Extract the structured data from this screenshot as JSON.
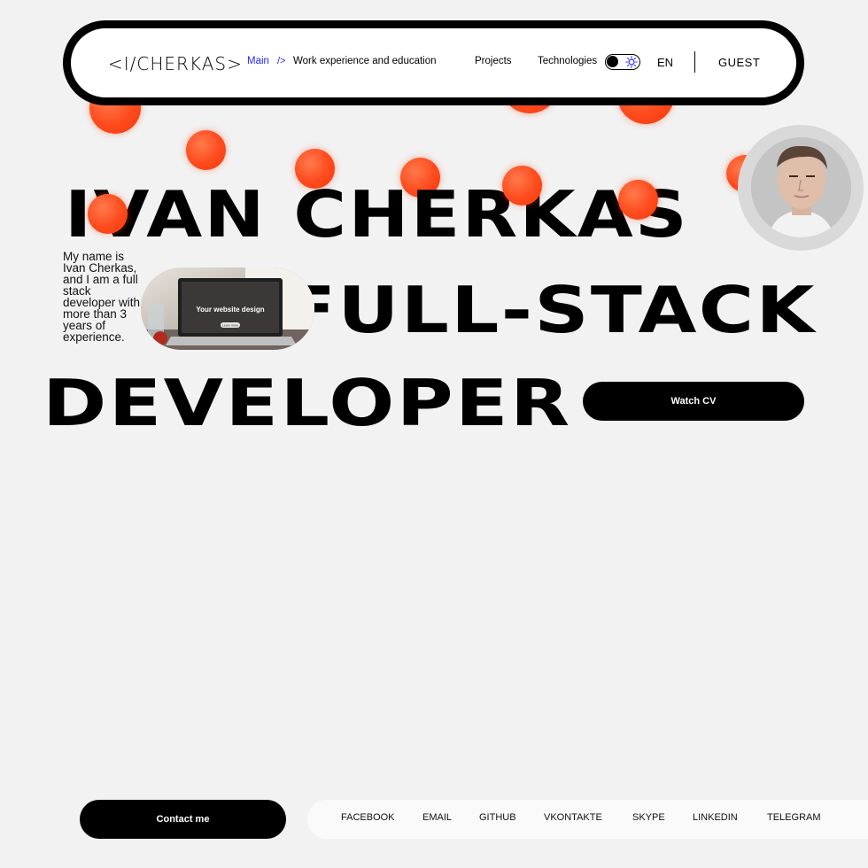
{
  "header": {
    "logo": "<I/CHERKAS>",
    "nav": {
      "main": "Main",
      "main_suffix": "/>",
      "work": "Work experience and education",
      "projects": "Projects",
      "technologies": "Technologies"
    },
    "theme_toggle": {
      "state": "dark",
      "icon": "sun-icon"
    },
    "language": "EN",
    "user": "GUEST"
  },
  "hero": {
    "line1": "IVAN CHERKAS",
    "line2": "FULL-STACK",
    "line3": "DEVELOPER",
    "bio": "My name is Ivan Cherkas, and I am a full stack developer with more than 3 years of experience.",
    "image_caption": "Your website design",
    "image_button": "Learn more",
    "cv_button": "Watch CV"
  },
  "footer": {
    "contact_button": "Contact me",
    "socials": [
      "FACEBOOK",
      "EMAIL",
      "GITHUB",
      "VKONTAKTE",
      "SKYPE",
      "LINKEDIN",
      "TELEGRAM"
    ]
  },
  "colors": {
    "accent_blue": "#2424ff",
    "ball_orange": "#ff4a1c",
    "background": "#f2f2f2",
    "ink": "#000000"
  }
}
